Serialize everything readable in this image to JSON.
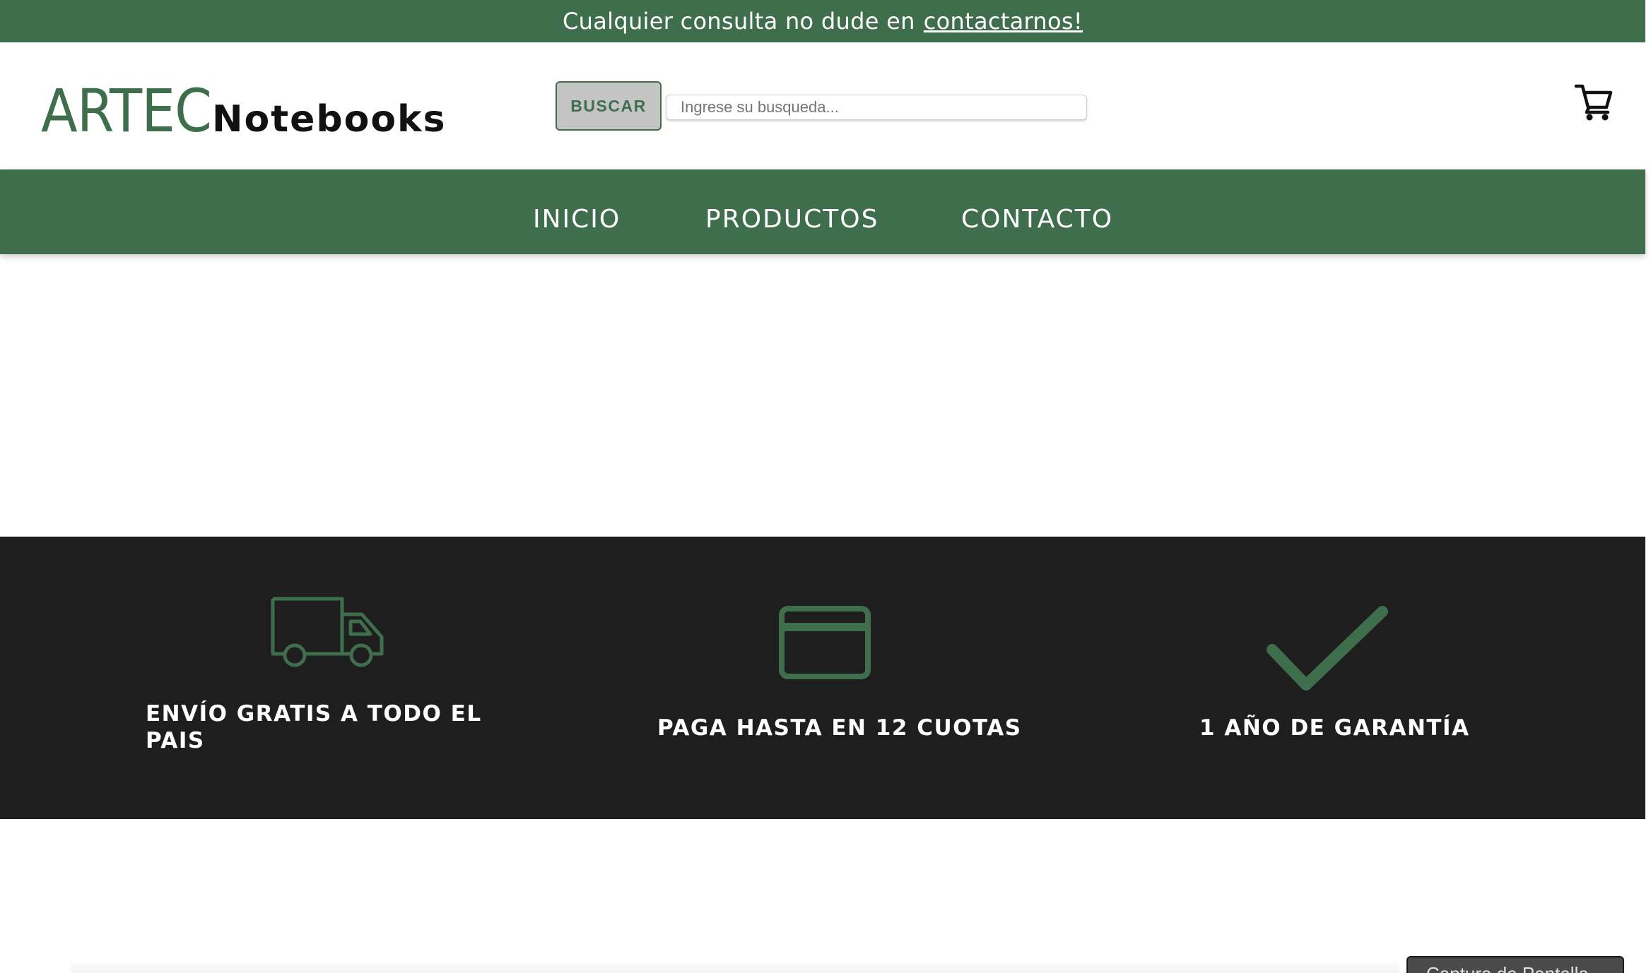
{
  "topbar": {
    "text": "Cualquier consulta no dude en",
    "link": "contactarnos!"
  },
  "header": {
    "logo_main": "ARTEC",
    "logo_sub": "Notebooks",
    "search_button": "BUSCAR",
    "search_placeholder": "Ingrese su busqueda...",
    "cart_icon": "shopping-cart-icon"
  },
  "nav": {
    "items": [
      {
        "label": "INICIO"
      },
      {
        "label": "PRODUCTOS"
      },
      {
        "label": "CONTACTO"
      }
    ]
  },
  "features": [
    {
      "icon": "truck-icon",
      "text_line1": "ENVÍO GRATIS A TODO EL",
      "text_line2": "PAIS"
    },
    {
      "icon": "credit-card-icon",
      "text": "PAGA HASTA EN 12 CUOTAS"
    },
    {
      "icon": "checkmark-icon",
      "text": "1 AÑO DE GARANTÍA"
    }
  ],
  "capture_button": "Captura de Pantalla",
  "colors": {
    "brand_green": "#3f6e4c",
    "features_bg": "#1e1e1e",
    "search_button_bg": "#c4c4c4"
  }
}
